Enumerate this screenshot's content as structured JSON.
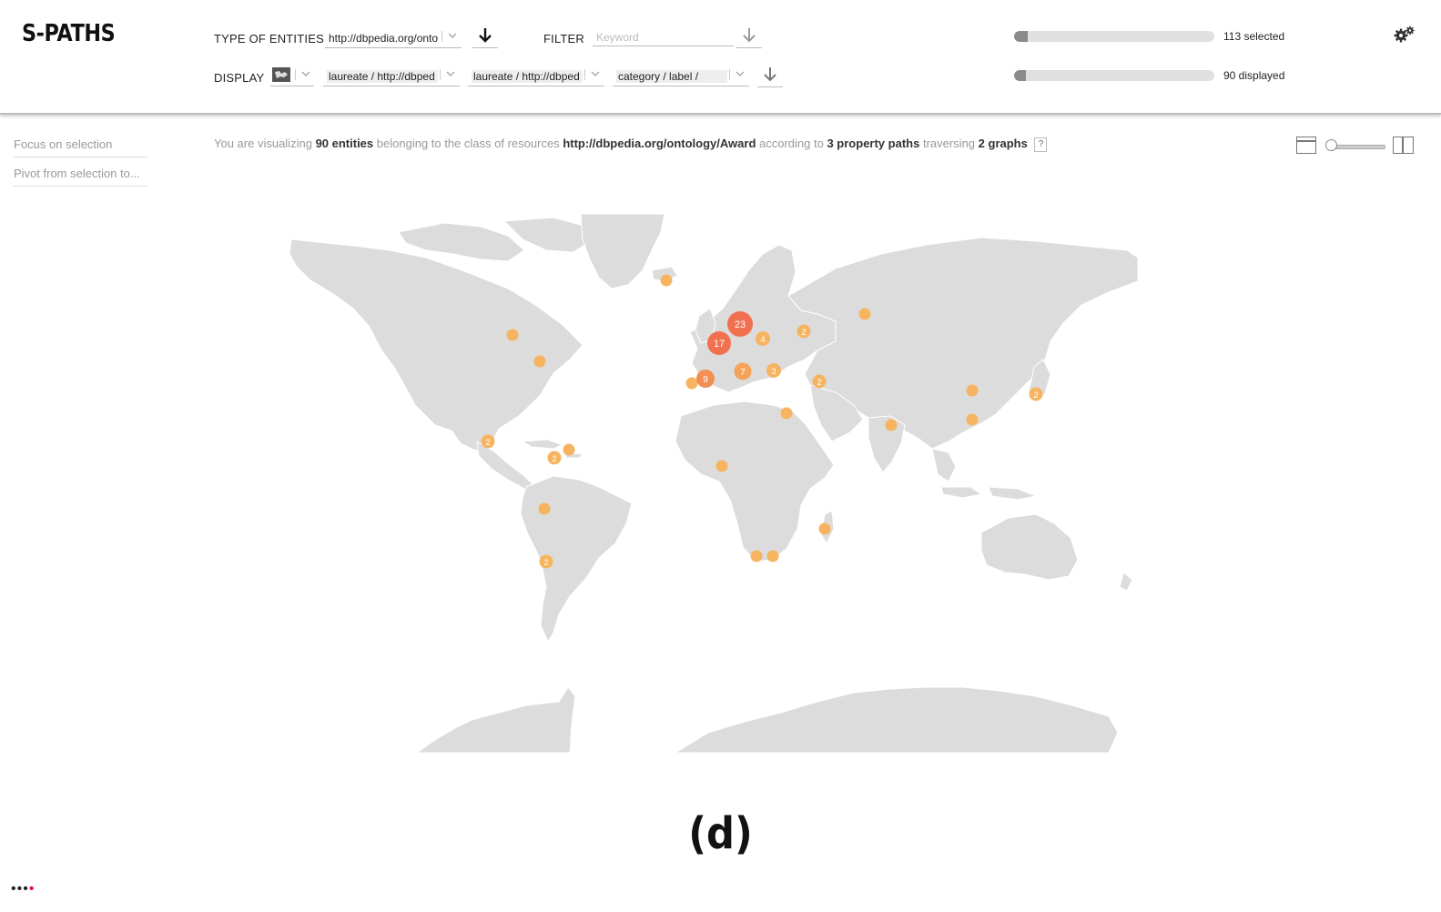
{
  "app": {
    "logo": "S-PATHS"
  },
  "header": {
    "type_label": "TYPE OF ENTITIES",
    "type_value": "http://dbpedia.org/onto",
    "filter_label": "FILTER",
    "filter_placeholder": "Keyword",
    "display_label": "DISPLAY",
    "display_view_icon": "map-view-icon",
    "display_paths": [
      {
        "value": "laureate /  http://dbped"
      },
      {
        "value": "laureate /  http://dbped"
      },
      {
        "value": "category /   label /"
      }
    ],
    "selected_text": "113 selected",
    "selected_fraction": 0.07,
    "displayed_text": "90 displayed",
    "displayed_fraction": 0.06
  },
  "sidebar": {
    "items": [
      {
        "label": "Focus on selection"
      },
      {
        "label": "Pivot from selection to..."
      }
    ]
  },
  "summary": {
    "prefix": "You are visualizing",
    "entities": "90 entities",
    "mid1": "belonging to the class of resources",
    "class_uri": "http://dbpedia.org/ontology/Award",
    "mid2": "according to",
    "paths": "3 property paths",
    "mid3": "traversing",
    "graphs": "2 graphs",
    "help": "?"
  },
  "map": {
    "land_color": "#dcdcdc",
    "clusters": [
      {
        "label": "23",
        "color": "#f07050",
        "size": "large"
      },
      {
        "label": "17",
        "color": "#f07050",
        "size": "large"
      },
      {
        "label": "9",
        "color": "#f28f55",
        "size": "medium"
      },
      {
        "label": "7",
        "color": "#f5a35a",
        "size": "medium"
      },
      {
        "label": "4",
        "color": "#f7b460",
        "size": "small"
      },
      {
        "label": "3",
        "color": "#f7b460",
        "size": "small"
      },
      {
        "label": "2",
        "color": "#f7b460",
        "size": "small"
      }
    ]
  },
  "caption": "(d)",
  "footer": {
    "dots": "••••"
  }
}
